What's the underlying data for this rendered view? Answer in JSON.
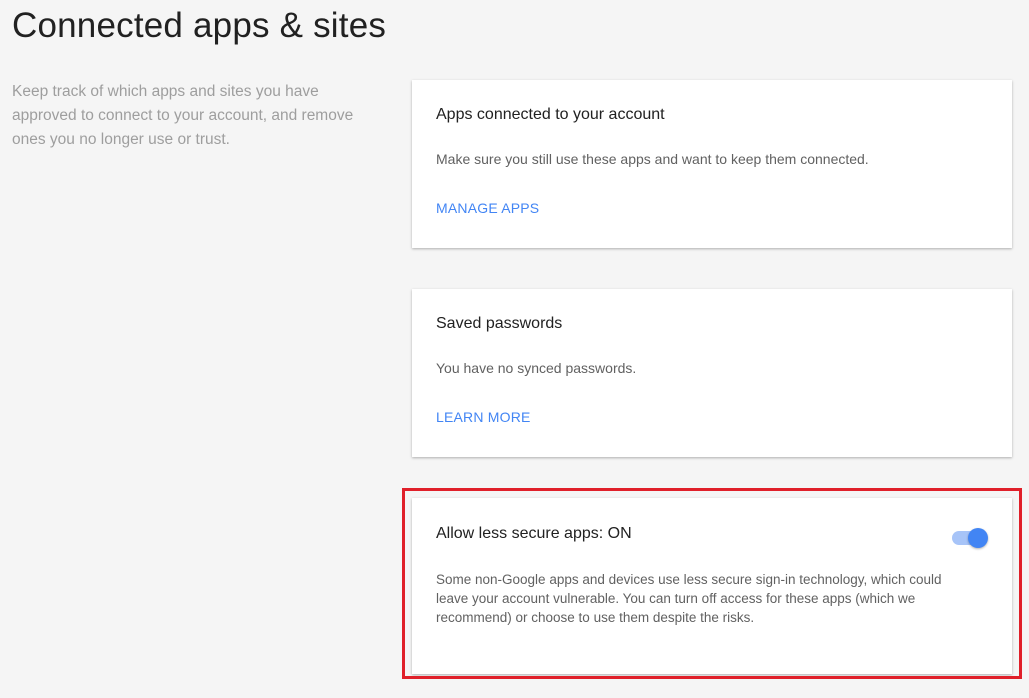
{
  "page": {
    "title": "Connected apps & sites",
    "intro": "Keep track of which apps and sites you have approved to connect to your account, and remove ones you no longer use or trust."
  },
  "cards": {
    "apps": {
      "title": "Apps connected to your account",
      "description": "Make sure you still use these apps and want to keep them connected.",
      "link": "MANAGE APPS"
    },
    "passwords": {
      "title": "Saved passwords",
      "description": "You have no synced passwords.",
      "link": "LEARN MORE"
    },
    "less_secure_apps": {
      "title": "Allow less secure apps: ON",
      "description": "Some non-Google apps and devices use less secure sign-in technology, which could leave your account vulnerable. You can turn off access for these apps (which we recommend) or choose to use them despite the risks.",
      "toggle_on": true
    }
  },
  "colors": {
    "accent": "#4285f4",
    "highlight": "#e0202a",
    "background": "#f5f5f5"
  }
}
